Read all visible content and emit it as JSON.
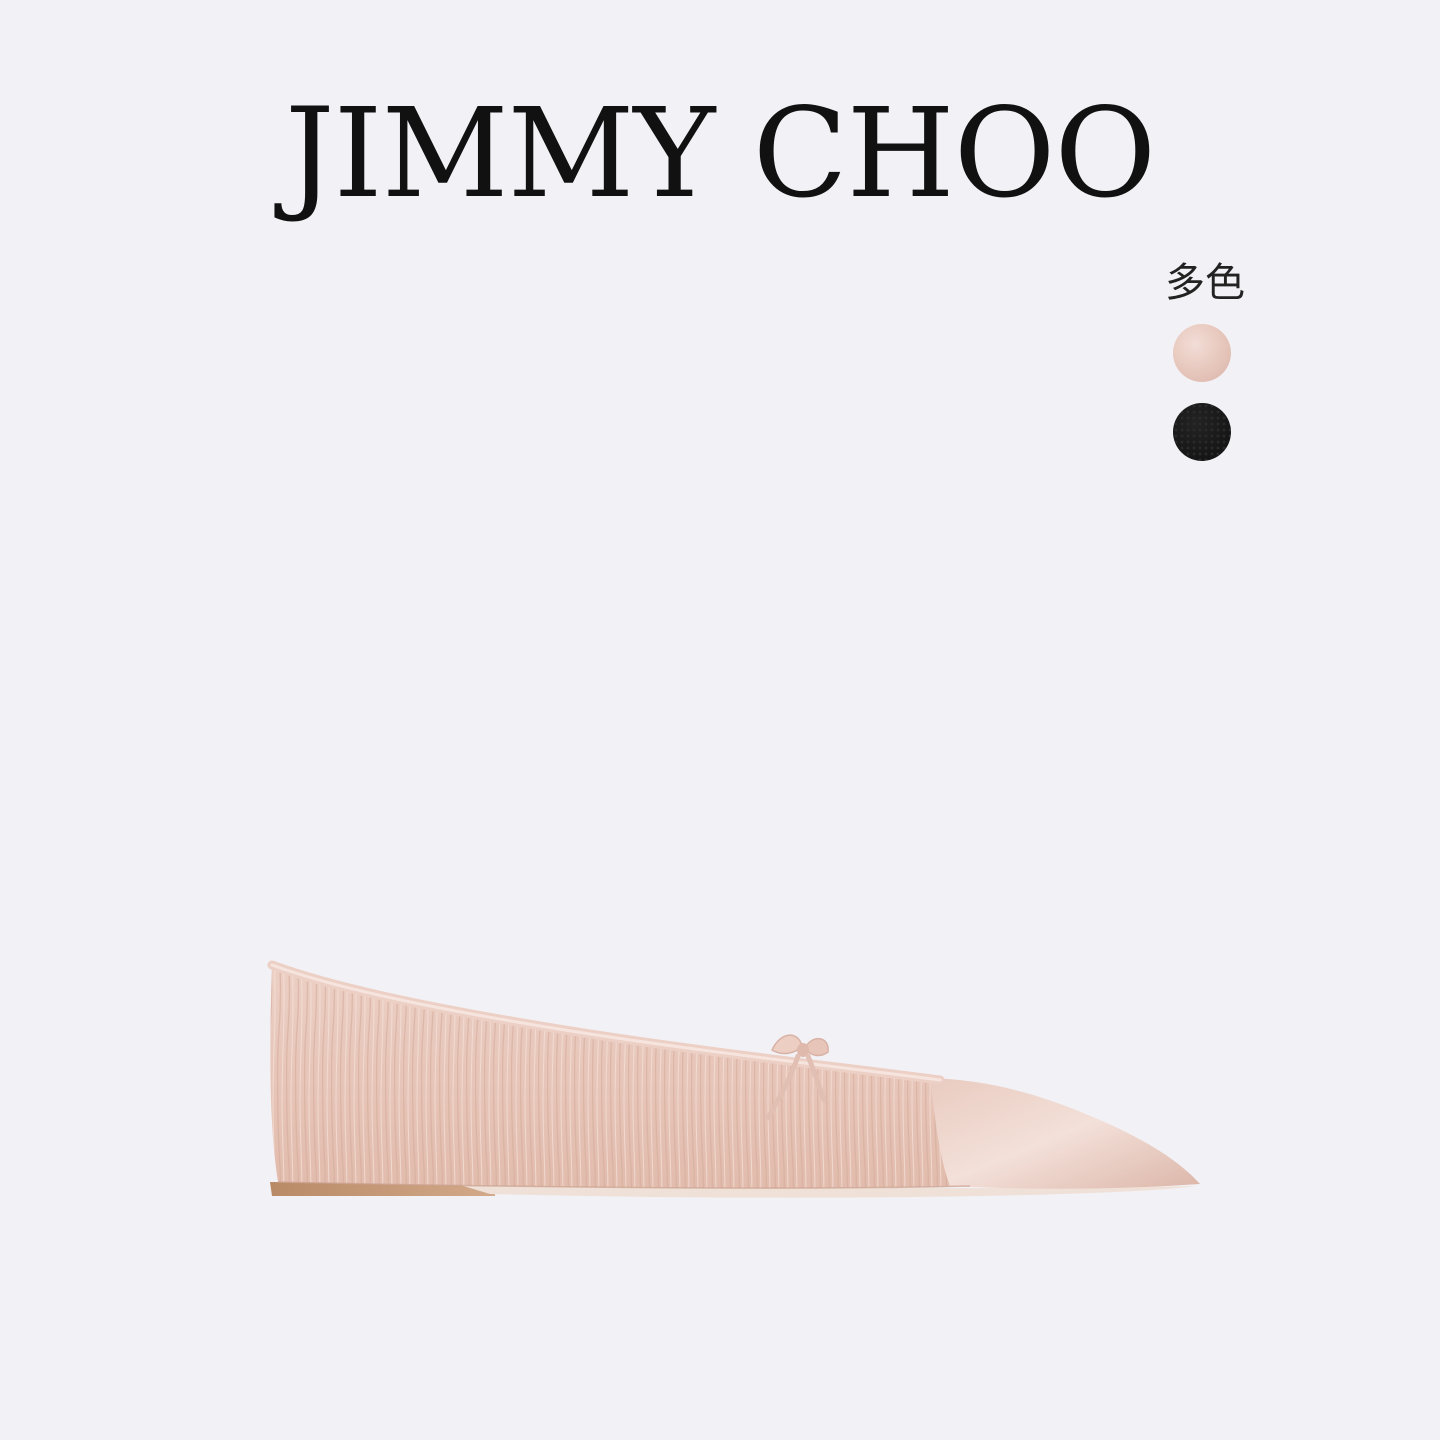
{
  "brand": {
    "name": "JIMMY CHOO"
  },
  "color_picker": {
    "label": "多色",
    "swatches": [
      {
        "name": "nude",
        "color": "#e3c3b8"
      },
      {
        "name": "black",
        "color": "#151515"
      }
    ]
  },
  "product": {
    "icon": "pointed-ballet-flat-image"
  }
}
